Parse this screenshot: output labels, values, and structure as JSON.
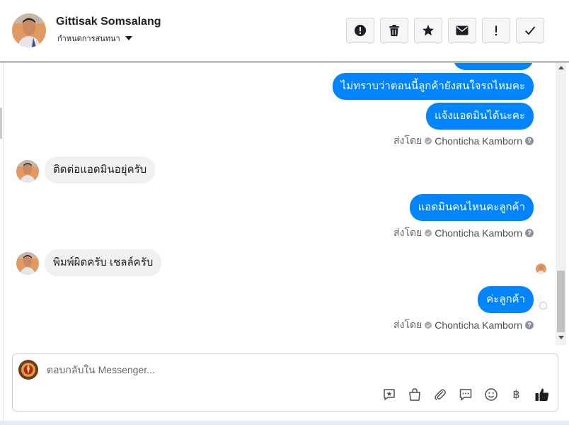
{
  "header": {
    "contact_name": "Gittisak Somsalang",
    "subtitle": "กำหนดการสนทนา",
    "actions": [
      {
        "name": "report-spam-button",
        "icon": "exclamation-circle-icon"
      },
      {
        "name": "delete-button",
        "icon": "trash-icon"
      },
      {
        "name": "star-button",
        "icon": "star-icon"
      },
      {
        "name": "mark-unread-button",
        "icon": "envelope-icon"
      },
      {
        "name": "follow-up-button",
        "icon": "exclamation-icon"
      },
      {
        "name": "mark-done-button",
        "icon": "checkmark-icon"
      }
    ]
  },
  "conversation": {
    "messages": [
      {
        "text": "ไม่ทราบว่าตอนนี้ลูกค้ายังสนใจรถไหมคะ"
      },
      {
        "text": "แจ้งแอดมินได้นะคะ"
      },
      {
        "text": "ติดต่อแอดมินอยุ่ครับ"
      },
      {
        "text": "แอดมินคนไหนคะลูกค้า"
      },
      {
        "text": "พิมพ์ผิดครับ เชลล์ครับ"
      },
      {
        "text": "ค่ะลูกค้า"
      }
    ],
    "sent_by_label": "ส่งโดย",
    "agent_name": "Chonticha Kamborn",
    "help_glyph": "?"
  },
  "composer": {
    "placeholder": "ตอบกลับใน Messenger...",
    "tools": [
      {
        "name": "saved-reply-icon"
      },
      {
        "name": "shop-bag-icon"
      },
      {
        "name": "attachment-icon"
      },
      {
        "name": "chat-bubble-icon"
      },
      {
        "name": "emoji-icon"
      },
      {
        "name": "baht-icon",
        "glyph": "฿"
      },
      {
        "name": "thumbs-up-icon"
      }
    ]
  },
  "colors": {
    "accent": "#0084ff",
    "bubble_in": "#f0f0f0",
    "like": "#1c1e21"
  }
}
